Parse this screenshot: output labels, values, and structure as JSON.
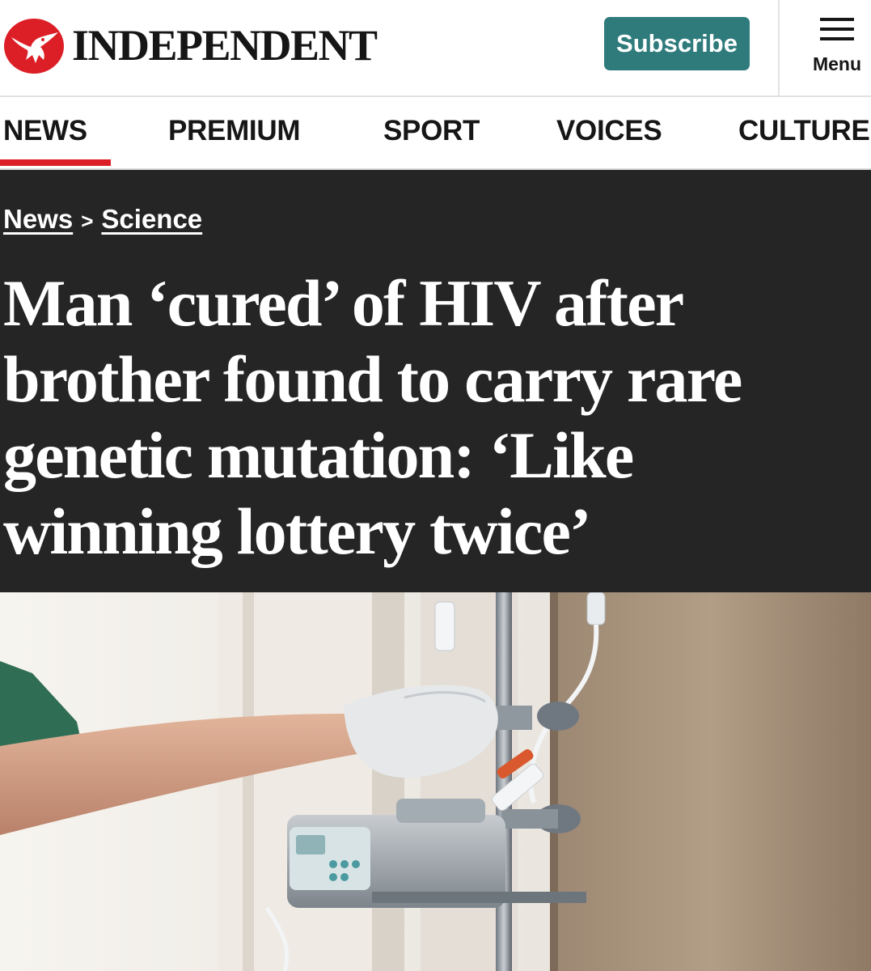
{
  "header": {
    "logo_text": "INDEPENDENT",
    "subscribe_label": "Subscribe",
    "menu_label": "Menu"
  },
  "nav": {
    "items": [
      {
        "label": "NEWS",
        "active": true
      },
      {
        "label": "PREMIUM"
      },
      {
        "label": "SPORT"
      },
      {
        "label": "VOICES"
      },
      {
        "label": "CULTURE"
      }
    ]
  },
  "breadcrumb": {
    "items": [
      "News",
      "Science"
    ],
    "separator": ">"
  },
  "article": {
    "headline": "Man ‘cured’ of HIV after brother found to carry rare genetic mutation: ‘Like winning lottery twice’"
  },
  "colors": {
    "brand_red": "#dc1f26",
    "subscribe_teal": "#2f7b7c",
    "headline_band": "#252525"
  },
  "icons": {
    "logo": "eagle-logo-icon",
    "menu": "hamburger-menu-icon"
  }
}
